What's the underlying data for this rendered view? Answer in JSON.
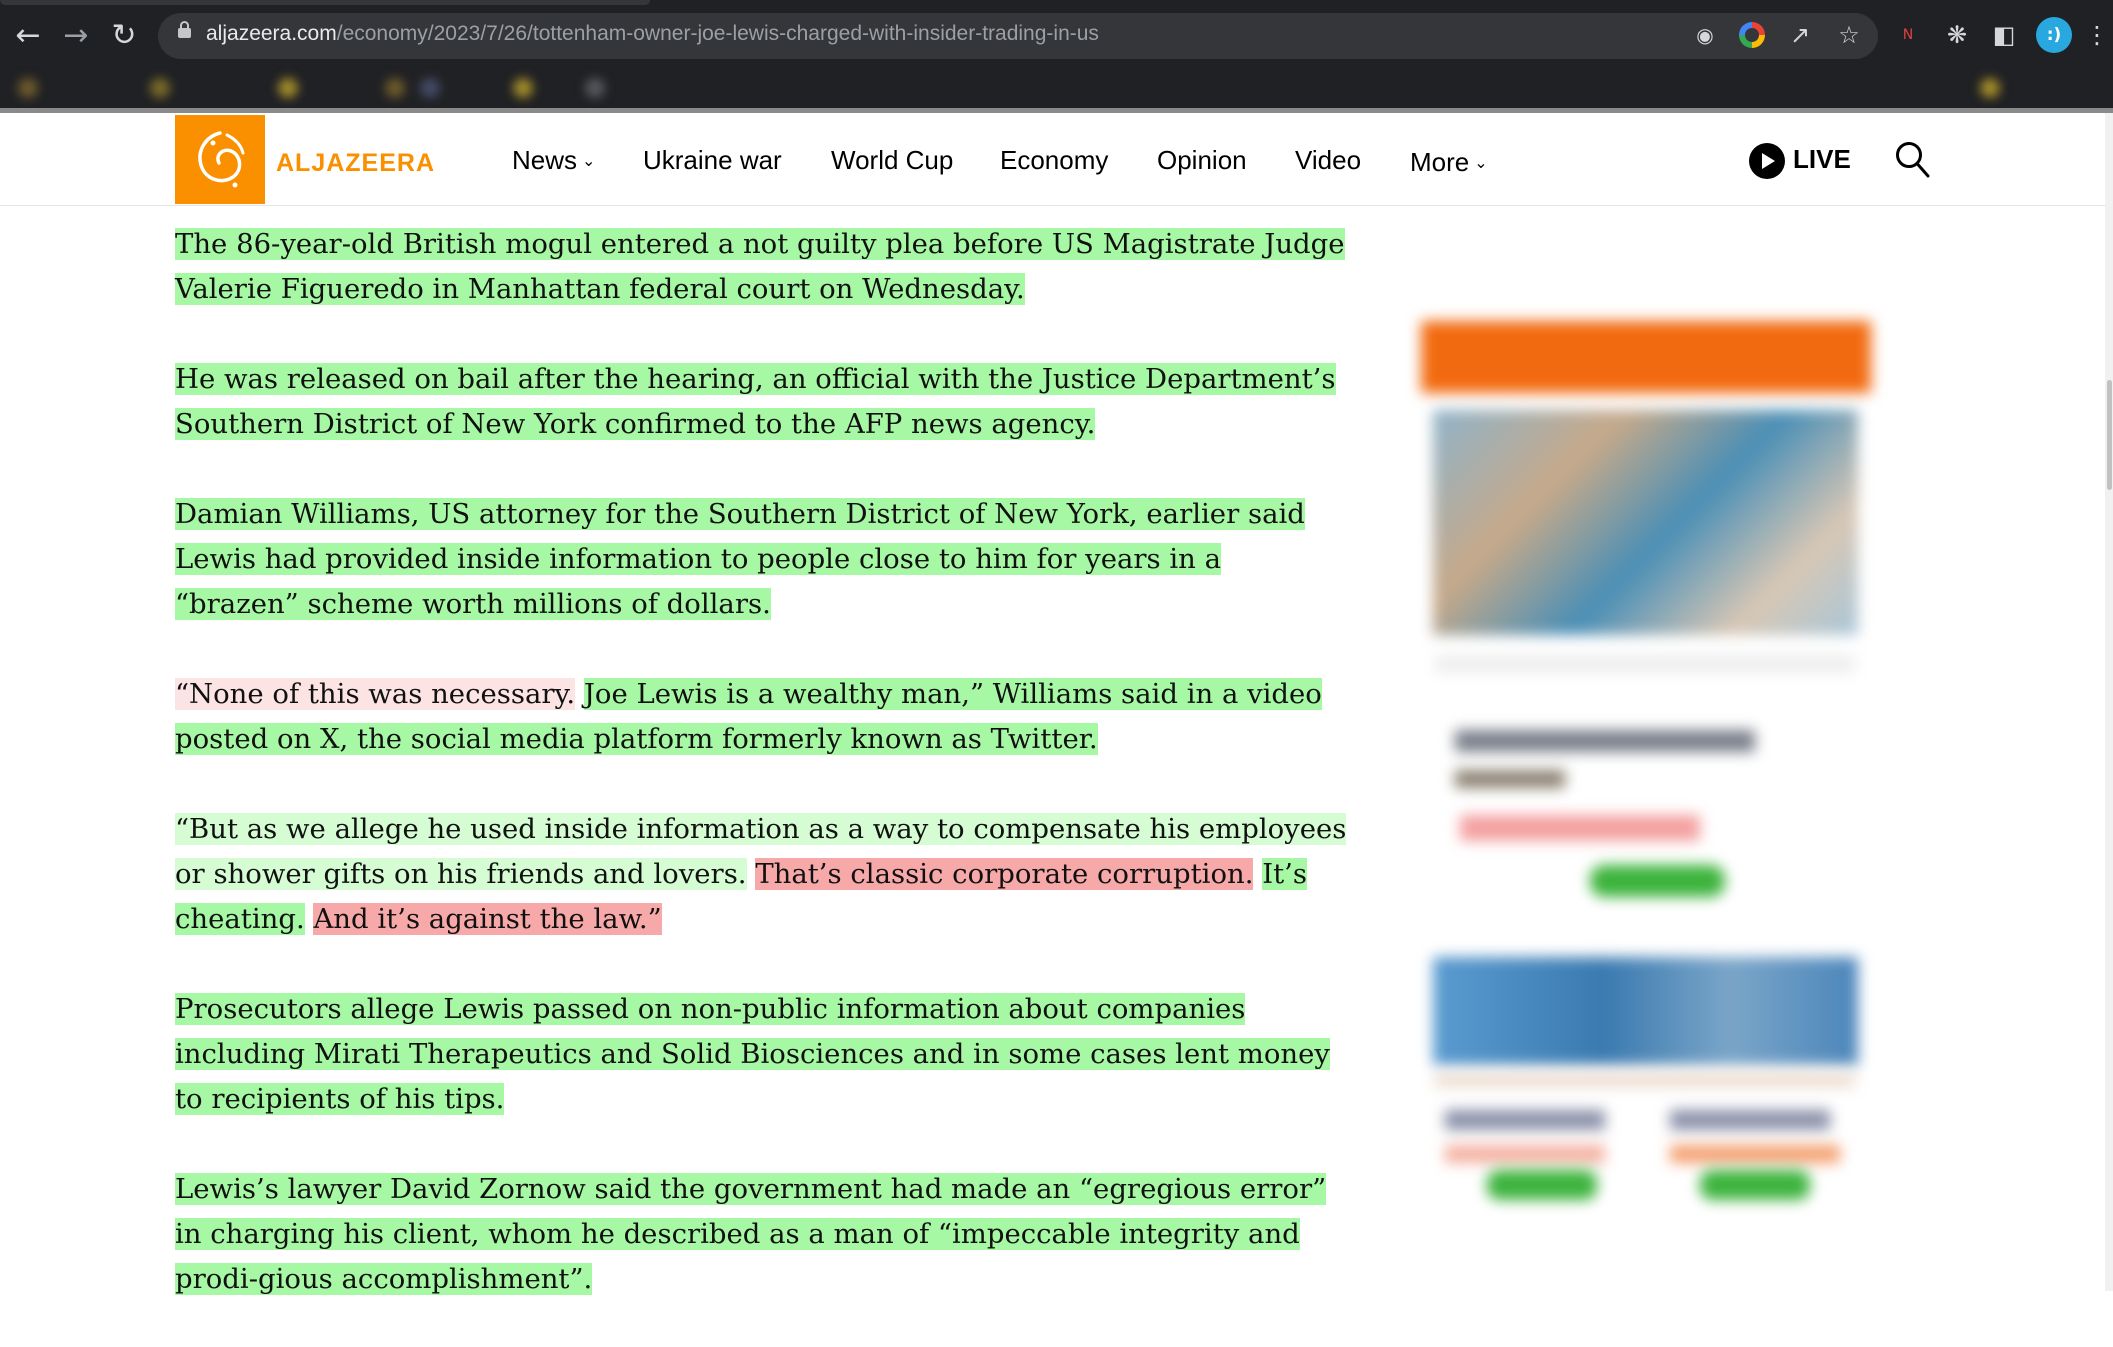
{
  "browser": {
    "url_host": "aljazeera.com",
    "url_path": "/economy/2023/7/26/tottenham-owner-joe-lewis-charged-with-insider-trading-in-us",
    "profile_label": ":)"
  },
  "site": {
    "logo_text": "ALJAZEERA",
    "nav": [
      "News",
      "Ukraine war",
      "World Cup",
      "Economy",
      "Opinion",
      "Video",
      "More"
    ],
    "live_label": "LIVE"
  },
  "article": {
    "p1": [
      "The 86-year-old British mogul entered a not guilty plea before US Magistrate Judge Valerie Figueredo in Manhattan federal court on Wednesday."
    ],
    "p2": [
      "He was released on bail after the hearing, an official with the Justice Department’s Southern District of New York confirmed to the AFP news agency."
    ],
    "p3": [
      "Damian Williams, US attorney for the Southern District of New York, earlier said Lewis had provided inside information to people close to him for years in a “brazen” scheme worth millions of dollars."
    ],
    "p4": [
      "“None of this was necessary.",
      "Joe Lewis is a wealthy man,” Williams said in a video posted on X, the social media platform formerly known as Twitter."
    ],
    "p5": [
      "“But as we allege he used inside information as a way to compensate his employees or shower gifts on his friends and lovers.",
      "That’s classic corporate corruption.",
      "It’s cheating.",
      "And it’s against the law.”"
    ],
    "p6": [
      "Prosecutors allege Lewis passed on non-public information about companies including Mirati Therapeutics and Solid Biosciences and in some cases lent money to recipients of his tips."
    ],
    "p7": [
      "Lewis’s lawyer David Zornow said the government had made an “egregious error” in charging his client, whom he described as a man of  “impeccable integrity and prodi-gious accomplishment”."
    ]
  },
  "highlight_colors": {
    "green": "#a7f8a4",
    "light_green": "#d5fcd3",
    "light_pink": "#fde4e4",
    "red": "#f7a9a9"
  }
}
